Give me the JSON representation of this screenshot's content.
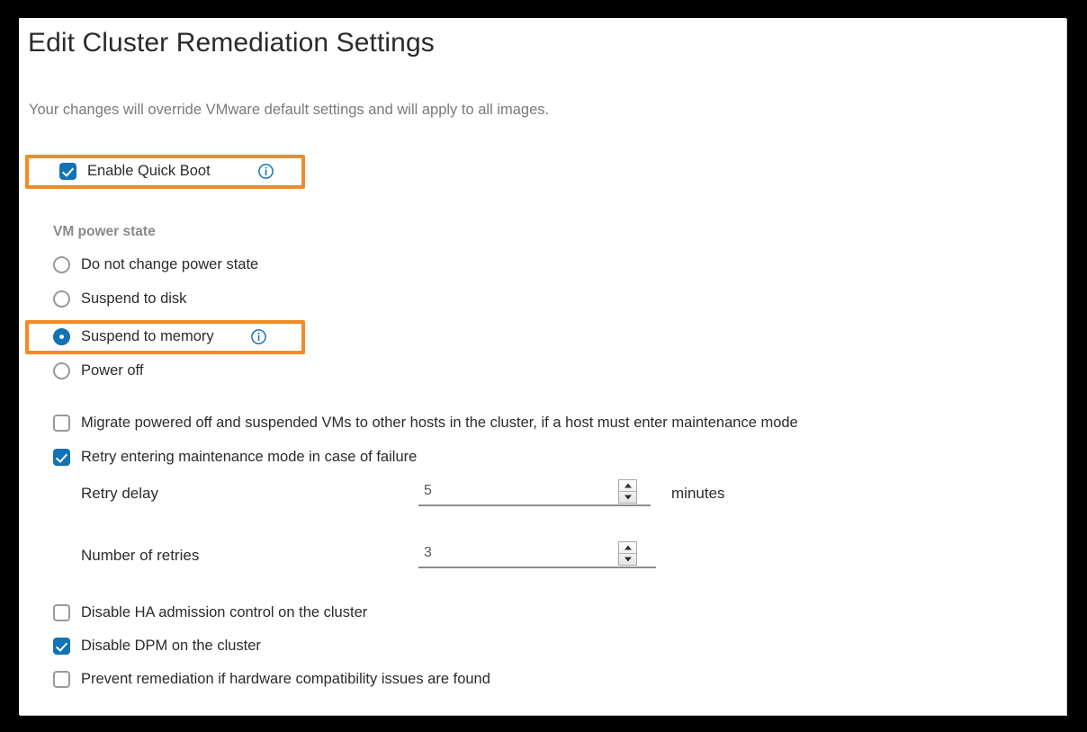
{
  "dialog": {
    "title": "Edit Cluster Remediation Settings",
    "subtitle": "Your changes will override VMware default settings and will apply to all images."
  },
  "quick_boot": {
    "label": "Enable Quick Boot",
    "checked": true,
    "info_icon": "info-circle-icon",
    "highlighted": true
  },
  "vm_power_state": {
    "group_label": "VM power state",
    "options": [
      {
        "label": "Do not change power state",
        "selected": false,
        "info_icon": null,
        "highlighted": false
      },
      {
        "label": "Suspend to disk",
        "selected": false,
        "info_icon": null,
        "highlighted": false
      },
      {
        "label": "Suspend to memory",
        "selected": true,
        "info_icon": "info-circle-icon",
        "highlighted": true
      },
      {
        "label": "Power off",
        "selected": false,
        "info_icon": null,
        "highlighted": false
      }
    ]
  },
  "maintenance": {
    "migrate": {
      "label": "Migrate powered off and suspended VMs to other hosts in the cluster, if a host must enter maintenance mode",
      "checked": false
    },
    "retry": {
      "label": "Retry entering maintenance mode in case of failure",
      "checked": true
    },
    "retry_delay": {
      "label": "Retry delay",
      "value": "5",
      "unit": "minutes"
    },
    "number_of_retries": {
      "label": "Number of retries",
      "value": "3",
      "unit": ""
    }
  },
  "cluster_options": [
    {
      "label": "Disable HA admission control on the cluster",
      "checked": false
    },
    {
      "label": "Disable DPM on the cluster",
      "checked": true
    },
    {
      "label": "Prevent remediation if hardware compatibility issues are found",
      "checked": false
    }
  ],
  "colors": {
    "accent_blue": "#1272b5",
    "highlight_orange": "#f08c23",
    "title_text": "#2b2b2b",
    "muted_text": "#7a7a7a",
    "frame_background": "#000000"
  }
}
